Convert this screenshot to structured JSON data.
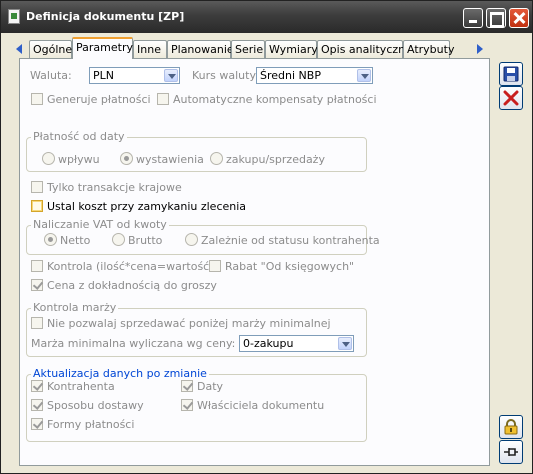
{
  "window": {
    "title": "Definicja dokumentu [ZP]"
  },
  "tabs": [
    {
      "label": "Ogólne",
      "active": false
    },
    {
      "label": "Parametry",
      "active": true
    },
    {
      "label": "Inne",
      "active": false
    },
    {
      "label": "Planowanie",
      "active": false
    },
    {
      "label": "Serie",
      "active": false
    },
    {
      "label": "Wymiary",
      "active": false
    },
    {
      "label": "Opis analityczny",
      "active": false
    },
    {
      "label": "Atrybuty",
      "active": false
    }
  ],
  "form": {
    "waluta_label": "Waluta:",
    "waluta_value": "PLN",
    "kurs_label": "Kurs waluty:",
    "kurs_value": "Średni NBP",
    "generuje_platnosci": {
      "label": "Generuje płatności",
      "checked": false
    },
    "auto_kompensaty": {
      "label": "Automatyczne kompensaty płatności",
      "checked": false
    },
    "platnosc_group": {
      "title": "Płatność od daty",
      "options": [
        "wpływu",
        "wystawienia",
        "zakupu/sprzedaży"
      ],
      "selected": "wystawienia"
    },
    "tylko_krajowe": {
      "label": "Tylko transakcje krajowe",
      "checked": false
    },
    "ustal_koszt": {
      "label": "Ustal koszt przy zamykaniu zlecenia",
      "checked": false
    },
    "vat_group": {
      "title": "Naliczanie VAT od kwoty",
      "options": [
        "Netto",
        "Brutto",
        "Zależnie od statusu kontrahenta"
      ],
      "selected": "Netto"
    },
    "kontrola": {
      "label": "Kontrola (ilość*cena=wartość)",
      "checked": false
    },
    "rabat": {
      "label": "Rabat \"Od księgowych\"",
      "checked": false
    },
    "cena_groszy": {
      "label": "Cena z dokładnością do groszy",
      "checked": true
    },
    "marza_group": {
      "title": "Kontrola marży",
      "nie_pozwalaj": {
        "label": "Nie pozwalaj sprzedawać poniżej marży minimalnej",
        "checked": false
      },
      "marza_min_label": "Marża minimalna wyliczana wg ceny:",
      "marza_min_value": "0-zakupu"
    },
    "aktualizacja_group": {
      "title": "Aktualizacja danych po zmianie",
      "kontrahenta": {
        "label": "Kontrahenta",
        "checked": true
      },
      "daty": {
        "label": "Daty",
        "checked": true
      },
      "sposobu_dostawy": {
        "label": "Sposobu dostawy",
        "checked": true
      },
      "wlasciciela": {
        "label": "Właściciela dokumentu",
        "checked": true
      },
      "formy_platnosci": {
        "label": "Formy płatności",
        "checked": true
      }
    }
  },
  "colors": {
    "title_bar": "#3c3c3c",
    "close_button": "#c03010",
    "group_title_blue": "#0046d5",
    "active_tab_accent": "#f0a030"
  }
}
